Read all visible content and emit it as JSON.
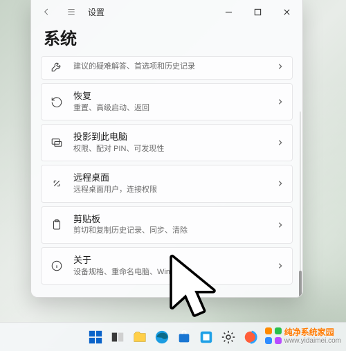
{
  "titlebar": {
    "app_name": "设置"
  },
  "page": {
    "title": "系统"
  },
  "items": [
    {
      "title": "",
      "subtitle": "建议的疑难解答、首选项和历史记录"
    },
    {
      "title": "恢复",
      "subtitle": "重置、高级启动、返回"
    },
    {
      "title": "投影到此电脑",
      "subtitle": "权限、配对 PIN、可发现性"
    },
    {
      "title": "远程桌面",
      "subtitle": "远程桌面用户，连接权限"
    },
    {
      "title": "剪贴板",
      "subtitle": "剪切和复制历史记录、同步、清除"
    },
    {
      "title": "关于",
      "subtitle": "设备规格、重命名电脑、Wind         规格"
    }
  ],
  "brand": {
    "name": "纯净系统家园",
    "url": "www.yidaimei.com"
  }
}
